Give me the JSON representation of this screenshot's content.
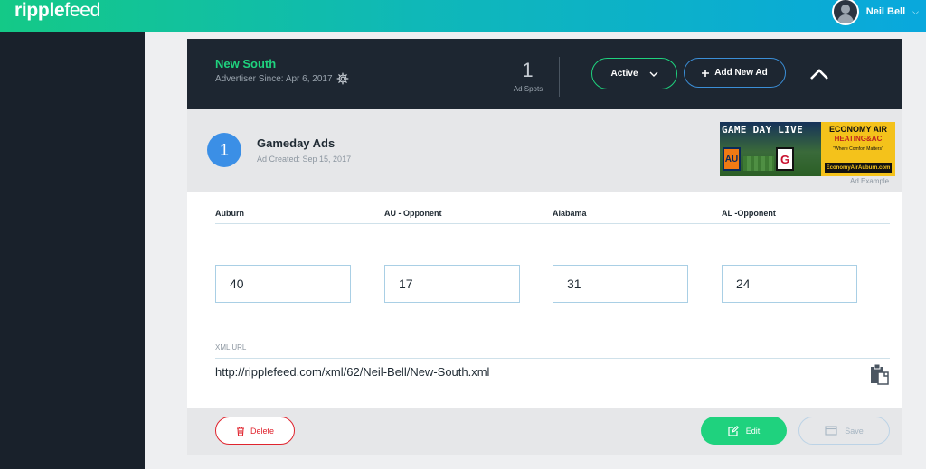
{
  "app": {
    "logo_bold": "ripple",
    "logo_light": "feed"
  },
  "user": {
    "name": "Neil Bell",
    "chevron": "⌵"
  },
  "advertiser": {
    "name": "New South",
    "since": "Advertiser Since: Apr 6, 2017",
    "ad_spots_count": "1",
    "ad_spots_label": "Ad Spots",
    "status_label": "Active",
    "add_ad_label": "Add New Ad"
  },
  "ad": {
    "number": "1",
    "title": "Gameday Ads",
    "created": "Ad Created: Sep 15, 2017",
    "example_caption": "Ad Example",
    "banner": {
      "left_title": "GAME DAY LIVE",
      "team1_logo": "AU",
      "team2_logo": "G",
      "right_title": "ECONOMY AIR",
      "right_sub": "HEATING&AC",
      "right_tagline": "\"Where Comfort Matters\"",
      "right_url": "EconomyAirAuburn.com"
    }
  },
  "scores": [
    {
      "label": "Auburn",
      "value": "40"
    },
    {
      "label": "AU - Opponent",
      "value": "17"
    },
    {
      "label": "Alabama",
      "value": "31"
    },
    {
      "label": "AL -Opponent",
      "value": "24"
    }
  ],
  "xml": {
    "label": "XML URL",
    "url": "http://ripplefeed.com/xml/62/Neil-Bell/New-South.xml"
  },
  "actions": {
    "delete_label": "Delete",
    "edit_label": "Edit",
    "save_label": "Save"
  },
  "colors": {
    "accent_green": "#1fd27e",
    "accent_blue": "#3b8fe6",
    "danger_red": "#e0242e",
    "dark_panel": "#1d2631"
  }
}
